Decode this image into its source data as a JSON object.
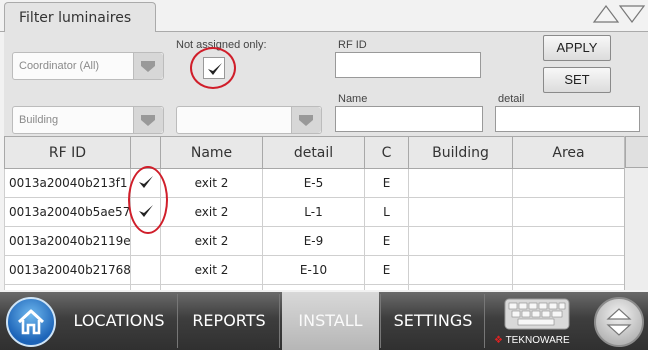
{
  "tab": {
    "label": "Filter luminaires"
  },
  "filters": {
    "not_assigned_label": "Not assigned only:",
    "not_assigned_checked": true,
    "rfid_label": "RF ID",
    "name_label": "Name",
    "detail_label": "detail",
    "coordinator_placeholder": "Coordinator (All)",
    "building_placeholder": "Building",
    "area_placeholder": ""
  },
  "actions": {
    "apply_label": "APPLY",
    "set_label": "SET"
  },
  "table": {
    "columns": [
      "RF ID",
      "",
      "Name",
      "detail",
      "C",
      "Building",
      "Area"
    ],
    "rows": [
      {
        "rfid": "0013a20040b213f1",
        "checked": true,
        "name": "exit 2",
        "detail": "E-5",
        "c": "E",
        "building": "",
        "area": ""
      },
      {
        "rfid": "0013a20040b5ae57",
        "checked": true,
        "name": "exit 2",
        "detail": "L-1",
        "c": "L",
        "building": "",
        "area": ""
      },
      {
        "rfid": "0013a20040b2119e",
        "checked": false,
        "name": "exit 2",
        "detail": "E-9",
        "c": "E",
        "building": "",
        "area": ""
      },
      {
        "rfid": "0013a20040b21768",
        "checked": false,
        "name": "exit 2",
        "detail": "E-10",
        "c": "E",
        "building": "",
        "area": ""
      },
      {
        "rfid": "",
        "checked": false,
        "name": "",
        "detail": "",
        "c": "",
        "building": "",
        "area": ""
      }
    ]
  },
  "nav": {
    "items": [
      {
        "label": "LOCATIONS",
        "active": false
      },
      {
        "label": "REPORTS",
        "active": false
      },
      {
        "label": "INSTALL",
        "active": true
      },
      {
        "label": "SETTINGS",
        "active": false
      }
    ],
    "brand": "TEKNOWARE",
    "icons": [
      "home-icon",
      "keyboard-icon",
      "scroll-up-down-icon",
      "up-down-arrows-icon"
    ]
  },
  "colors": {
    "highlight_ring": "#d01e2a",
    "home_blue": "#1d64b8",
    "footer_dark": "#303030"
  }
}
